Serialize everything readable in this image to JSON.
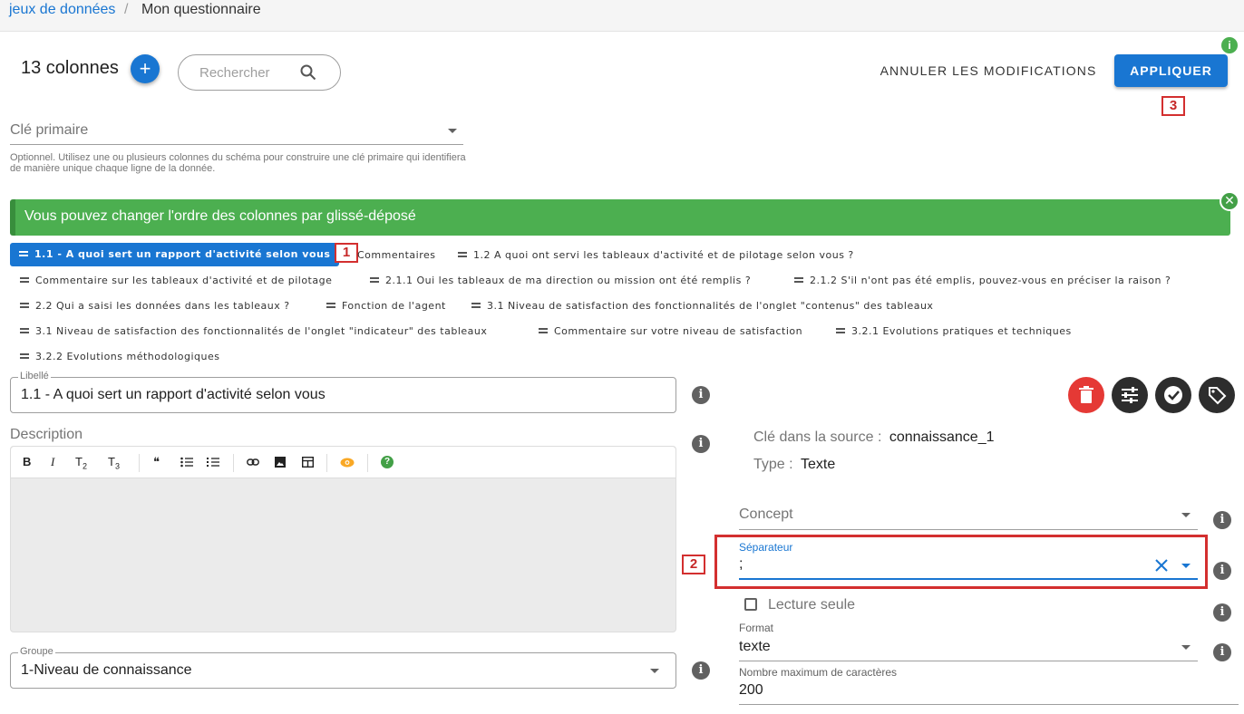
{
  "breadcrumb": {
    "parent": "jeux de données",
    "separator": "/",
    "current": "Mon questionnaire"
  },
  "header": {
    "columns_count": "13 colonnes",
    "add_icon": "plus-icon",
    "search_placeholder": "Rechercher",
    "cancel_label": "ANNULER LES MODIFICATIONS",
    "apply_label": "APPLIQUER",
    "info_icon": "i"
  },
  "markers": {
    "m1": "1",
    "m2": "2",
    "m3": "3"
  },
  "primary_key": {
    "label": "Clé primaire",
    "hint": "Optionnel. Utilisez une ou plusieurs colonnes du schéma pour construire une clé primaire qui identifiera de manière unique chaque ligne de la donnée."
  },
  "banner": {
    "text": "Vous pouvez changer l'ordre des colonnes par glissé-déposé",
    "close": "✕"
  },
  "columns": [
    "1.1 - A quoi sert un rapport d'activité selon vous",
    "Commentaires",
    "1.2 A quoi ont servi les tableaux d'activité et de pilotage selon vous ?",
    "Commentaire sur les tableaux d'activité et de pilotage",
    "2.1.1 Oui les tableaux de ma direction ou mission ont été remplis ?",
    "2.1.2 S'il n'ont pas été emplis, pouvez-vous en préciser la raison ?",
    "2.2 Qui a saisi les données dans les tableaux ?",
    "Fonction de l'agent",
    "3.1 Niveau de satisfaction des fonctionnalités de l'onglet \"contenus\" des tableaux",
    "3.1 Niveau de satisfaction des fonctionnalités de l'onglet \"indicateur\" des tableaux",
    "Commentaire sur votre niveau de satisfaction",
    "3.2.1 Evolutions pratiques et techniques",
    "3.2.2 Evolutions méthodologiques"
  ],
  "libelle": {
    "label": "Libellé",
    "value": "1.1 - A quoi sert un rapport d'activité selon vous"
  },
  "description": {
    "label": "Description",
    "toolbar": {
      "bold": "B",
      "italic": "I",
      "t2": "T",
      "t2_sub": "2",
      "t3": "T",
      "t3_sub": "3",
      "quote": "❝",
      "help": "?"
    }
  },
  "groupe": {
    "label": "Groupe",
    "value": "1-Niveau de connaissance"
  },
  "details": {
    "source_key_label": "Clé dans la source :",
    "source_key_value": "connaissance_1",
    "type_label": "Type :",
    "type_value": "Texte"
  },
  "concept": {
    "label": "Concept"
  },
  "separateur": {
    "label": "Séparateur",
    "value": ";"
  },
  "lecture_seule": {
    "label": "Lecture seule"
  },
  "format": {
    "label": "Format",
    "value": "texte"
  },
  "max_chars": {
    "label": "Nombre maximum de caractères",
    "value": "200"
  },
  "colors": {
    "primary": "#1976d2",
    "success": "#4caf50",
    "danger": "#e53935",
    "marker": "#d32f2f"
  }
}
